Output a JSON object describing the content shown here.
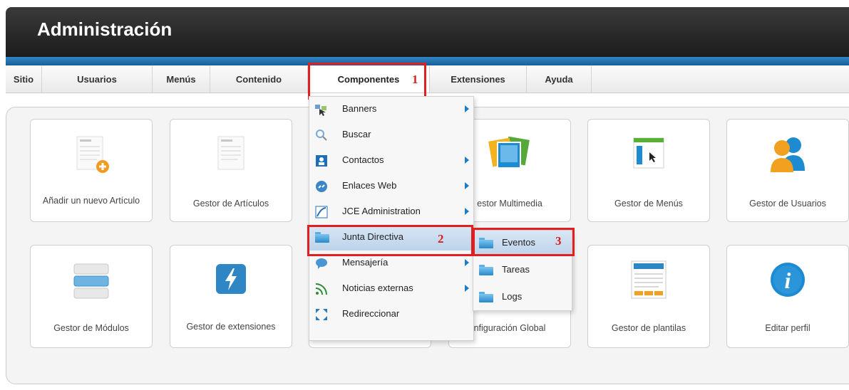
{
  "header": {
    "title": "Administración"
  },
  "menubar": {
    "items": [
      "Sitio",
      "Usuarios",
      "Menús",
      "Contenido",
      "Componentes",
      "Extensiones",
      "Ayuda"
    ],
    "active": "Componentes"
  },
  "annotations": {
    "n1": "1",
    "n2": "2",
    "n3": "3"
  },
  "tiles": {
    "add_article": "Añadir un nuevo Artículo",
    "article_manager": "Gestor de Artículos",
    "media_manager": "estor Multimedia",
    "menu_manager": "Gestor de Menús",
    "user_manager": "Gestor de Usuarios",
    "module_manager": "Gestor de Módulos",
    "extension_manager": "Gestor de extensiones",
    "global_config": "nfiguración Global",
    "template_manager": "Gestor de plantilas",
    "edit_profile": "Editar perfil"
  },
  "dropdown": {
    "items": [
      {
        "label": "Banners",
        "icon": "banners-icon",
        "submenu": true
      },
      {
        "label": "Buscar",
        "icon": "search-icon",
        "submenu": false
      },
      {
        "label": "Contactos",
        "icon": "contacts-icon",
        "submenu": true
      },
      {
        "label": "Enlaces Web",
        "icon": "weblinks-icon",
        "submenu": true
      },
      {
        "label": "JCE Administration",
        "icon": "jce-icon",
        "submenu": true
      },
      {
        "label": "Junta Directiva",
        "icon": "folder-icon",
        "submenu": false
      },
      {
        "label": "Mensajería",
        "icon": "messaging-icon",
        "submenu": true
      },
      {
        "label": "Noticias externas",
        "icon": "rss-icon",
        "submenu": true
      },
      {
        "label": "Redireccionar",
        "icon": "redirect-icon",
        "submenu": false
      }
    ],
    "highlighted": "Junta Directiva"
  },
  "submenu": {
    "items": [
      "Eventos",
      "Tareas",
      "Logs"
    ],
    "highlighted": "Eventos"
  },
  "colors": {
    "accent_blue": "#1b7dc3",
    "annotation_red": "#e02020",
    "header_dark": "#262626"
  }
}
